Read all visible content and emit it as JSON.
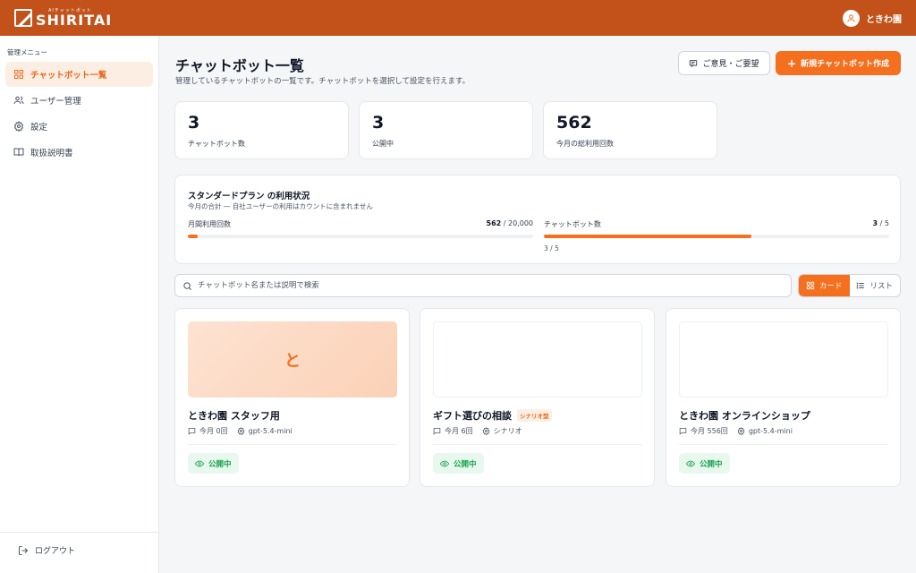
{
  "header": {
    "logo_sub": "AIチャットボット",
    "logo_main": "SHIRITAI",
    "user_name": "ときわ園"
  },
  "sidebar": {
    "title": "管理メニュー",
    "items": [
      {
        "label": "チャットボット一覧",
        "icon": "grid-icon",
        "active": true
      },
      {
        "label": "ユーザー管理",
        "icon": "users-icon",
        "active": false
      },
      {
        "label": "設定",
        "icon": "gear-icon",
        "active": false
      },
      {
        "label": "取扱説明書",
        "icon": "book-icon",
        "active": false
      }
    ],
    "logout": "ログアウト"
  },
  "page": {
    "title": "チャットボット一覧",
    "subtitle": "管理しているチャットボットの一覧です。チャットボットを選択して設定を行えます。",
    "feedback_button": "ご意見・ご要望",
    "create_button": "新規チャットボット作成"
  },
  "stats": [
    {
      "value": "3",
      "label": "チャットボット数"
    },
    {
      "value": "3",
      "label": "公開中"
    },
    {
      "value": "562",
      "label": "今月の総利用回数"
    }
  ],
  "usage": {
    "title": "スタンダードプラン の利用状況",
    "subtitle": "今月の合計 ― 自社ユーザーの利用はカウントに含まれません",
    "monthly": {
      "label": "月間利用回数",
      "used": "562",
      "limit": " / 20,000",
      "fraction": 0.0281
    },
    "bots": {
      "label": "チャットボット数",
      "used": "3",
      "limit": " / 5",
      "fraction": 0.6,
      "foot": "3 / 5"
    }
  },
  "search": {
    "placeholder": "チャットボット名または説明で検索",
    "value": ""
  },
  "view_toggle": {
    "card": "カード",
    "list": "リスト",
    "selected": "card"
  },
  "cards": [
    {
      "title": "ときわ園 スタッフ用",
      "thumb_letter": "と",
      "badge": "",
      "usage": "今月 0回",
      "model": "gpt-5.4-mini",
      "status": "公開中"
    },
    {
      "title": "ギフト選びの相談",
      "thumb_letter": "",
      "badge": "シナリオ型",
      "usage": "今月 6回",
      "model": "シナリオ",
      "status": "公開中"
    },
    {
      "title": "ときわ園 オンラインショップ",
      "thumb_letter": "",
      "badge": "",
      "usage": "今月 556回",
      "model": "gpt-5.4-mini",
      "status": "公開中"
    }
  ],
  "colors": {
    "header": "#c2521a",
    "accent": "#f46f1e",
    "status_green": "#16a34a"
  }
}
